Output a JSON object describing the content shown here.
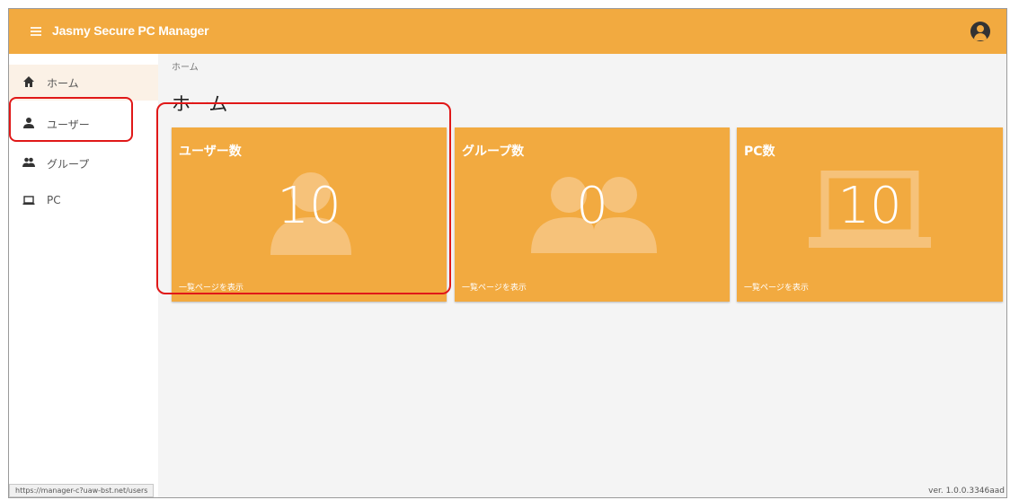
{
  "header": {
    "title": "Jasmy Secure PC Manager",
    "icons": {
      "menu": "menu-icon",
      "account": "account-circle-icon"
    }
  },
  "sidebar": {
    "items": [
      {
        "label": "ホーム",
        "icon": "home-icon",
        "active": true
      },
      {
        "label": "ユーザー",
        "icon": "person-icon",
        "active": false
      },
      {
        "label": "グループ",
        "icon": "people-icon",
        "active": false
      },
      {
        "label": "PC",
        "icon": "laptop-icon",
        "active": false
      }
    ]
  },
  "main": {
    "breadcrumb": "ホーム",
    "title": "ホーム",
    "cards": [
      {
        "title": "ユーザー数",
        "value": "10",
        "link": "一覧ページを表示",
        "icon": "person-icon"
      },
      {
        "title": "グループ数",
        "value": "0",
        "link": "一覧ページを表示",
        "icon": "people-icon"
      },
      {
        "title": "PC数",
        "value": "10",
        "link": "一覧ページを表示",
        "icon": "laptop-icon"
      }
    ]
  },
  "footer": {
    "status_url": "https://manager-c?uaw-bst.net/users",
    "version": "ver. 1.0.0.3346aad"
  },
  "colors": {
    "accent": "#f2aa40",
    "highlight": "#e01818",
    "sidebar_active": "#fbf1e6"
  }
}
